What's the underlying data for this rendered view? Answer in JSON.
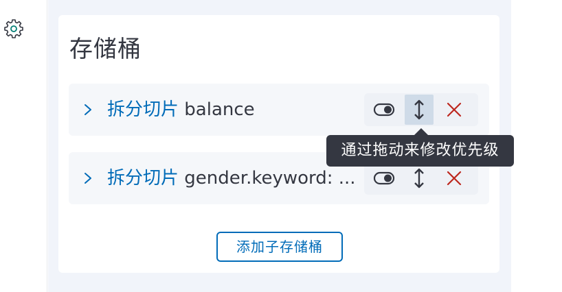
{
  "settings": {
    "icon": "gear-icon"
  },
  "panel": {
    "title": "存储桶",
    "buckets": [
      {
        "type": "拆分切片",
        "name": "balance",
        "actions": {
          "toggle_icon": "toggle-icon",
          "drag_icon": "drag-handle-icon",
          "remove_icon": "close-icon"
        }
      },
      {
        "type": "拆分切片",
        "name": "gender.keyword: ...",
        "actions": {
          "toggle_icon": "toggle-icon",
          "drag_icon": "drag-handle-icon",
          "remove_icon": "close-icon"
        }
      }
    ],
    "tooltip": "通过拖动来修改优先级",
    "add_button": "添加子存储桶"
  },
  "colors": {
    "accent": "#006bb8",
    "danger": "#bd271e",
    "text": "#343741",
    "tooltip_bg": "#343741",
    "panel_bg": "#f1f4fa"
  }
}
